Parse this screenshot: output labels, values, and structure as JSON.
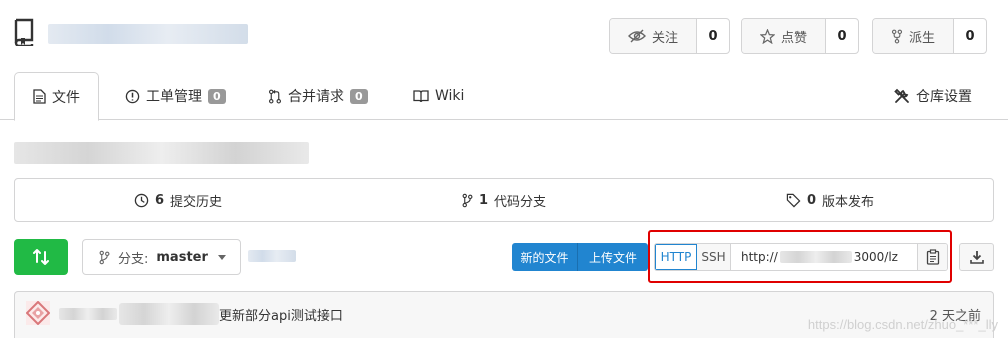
{
  "header": {
    "watch": {
      "label": "关注",
      "count": "0",
      "icon": "eye-slash-icon"
    },
    "star": {
      "label": "点赞",
      "count": "0",
      "icon": "star-icon"
    },
    "fork": {
      "label": "派生",
      "count": "0",
      "icon": "fork-icon"
    }
  },
  "tabs": [
    {
      "label": "文件",
      "icon": "file-text-icon",
      "active": true
    },
    {
      "label": "工单管理",
      "badge": "0",
      "icon": "info-circle-icon"
    },
    {
      "label": "合并请求",
      "badge": "0",
      "icon": "pull-request-icon"
    },
    {
      "label": "Wiki",
      "icon": "book-icon"
    }
  ],
  "settings_tab": {
    "label": "仓库设置",
    "icon": "tools-icon"
  },
  "stats": {
    "commits": {
      "count": "6",
      "label": "提交历史",
      "icon": "history-icon"
    },
    "branches": {
      "count": "1",
      "label": "代码分支",
      "icon": "branch-icon"
    },
    "releases": {
      "count": "0",
      "label": "版本发布",
      "icon": "tag-icon"
    }
  },
  "toolbar": {
    "branch_prefix": "分支:",
    "branch_name": "master",
    "new_file": "新的文件",
    "upload_file": "上传文件",
    "protocols": [
      "HTTP",
      "SSH"
    ],
    "url_prefix": "http://",
    "url_suffix": "3000/lz"
  },
  "commit": {
    "message": "更新部分api测试接口",
    "time": "2 天之前"
  },
  "watermark": "https://blog.csdn.net/zhuo_***_lly",
  "colors": {
    "green": "#21ba45",
    "blue": "#2185d0",
    "highlight": "#e00000"
  }
}
